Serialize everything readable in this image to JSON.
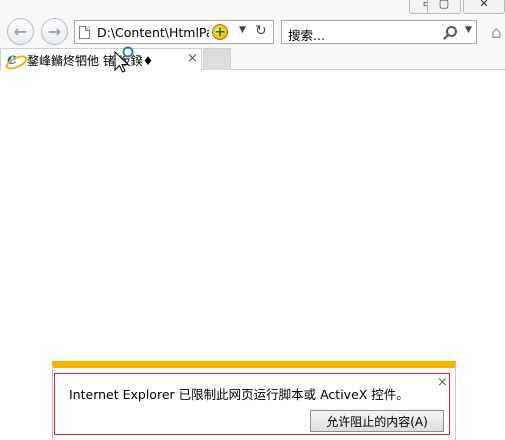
{
  "browser": {
    "address": "D:\\Content\\HtmlPag",
    "search_placeholder": "搜索...",
    "tab_title": "鍪峰鏅炵牭他   锗   坂鍨♦",
    "tab_close": "×"
  },
  "notification": {
    "message": "Internet Explorer 已限制此网页运行脚本或 ActiveX 控件。",
    "allow_button": "允许阻止的内容(A)",
    "close": "×"
  },
  "icons": {
    "back": "back-arrow-icon",
    "forward": "forward-arrow-icon",
    "page": "page-icon",
    "add_extension": "add-plus-icon",
    "refresh": "refresh-icon",
    "search": "search-icon",
    "home": "home-icon",
    "tab_favicon": "ie-logo-icon"
  },
  "colors": {
    "notification_bar": "#f4b400",
    "notification_border": "#d2232a"
  }
}
